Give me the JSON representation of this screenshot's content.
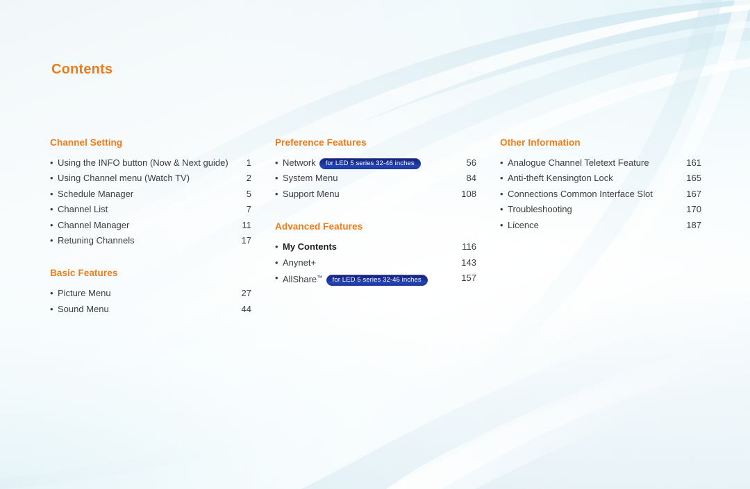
{
  "page": {
    "title": "Contents",
    "accent_orange": "#ef7b18",
    "badge_blue": "#1b3496",
    "text_color": "#3c3c3c",
    "background": "#ffffff"
  },
  "badge_text": "for LED 5 series 32-46 inches",
  "bullet_glyph": "•",
  "columns": [
    {
      "id": "column-1",
      "sections": [
        {
          "title": "Channel Setting",
          "items": [
            {
              "label": "Using the INFO button (Now & Next guide)",
              "page": "1",
              "bold": false,
              "badge": false
            },
            {
              "label": "Using Channel menu (Watch TV)",
              "page": "2",
              "bold": false,
              "badge": false
            },
            {
              "label": "Schedule Manager",
              "page": "5",
              "bold": false,
              "badge": false
            },
            {
              "label": "Channel List",
              "page": "7",
              "bold": false,
              "badge": false
            },
            {
              "label": "Channel Manager",
              "page": "11",
              "bold": false,
              "badge": false
            },
            {
              "label": "Retuning Channels",
              "page": "17",
              "bold": false,
              "badge": false
            }
          ]
        },
        {
          "title": "Basic Features",
          "items": [
            {
              "label": "Picture Menu",
              "page": "27",
              "bold": false,
              "badge": false
            },
            {
              "label": "Sound Menu",
              "page": "44",
              "bold": false,
              "badge": false
            }
          ]
        }
      ]
    },
    {
      "id": "column-2",
      "sections": [
        {
          "title": "Preference Features",
          "items": [
            {
              "label": "Network",
              "page": "56",
              "bold": true,
              "badge": true
            },
            {
              "label": "System Menu",
              "page": "84",
              "bold": false,
              "badge": false
            },
            {
              "label": "Support Menu",
              "page": "108",
              "bold": false,
              "badge": false
            }
          ]
        },
        {
          "title": "Advanced Features",
          "items": [
            {
              "label": "My Contents",
              "page": "116",
              "bold": true,
              "badge": false
            },
            {
              "label": "Anynet+",
              "page": "143",
              "bold": false,
              "badge": false
            },
            {
              "label": "AllShare",
              "trademark": true,
              "page": "157",
              "bold": true,
              "badge": true
            }
          ]
        }
      ]
    },
    {
      "id": "column-3",
      "sections": [
        {
          "title": "Other Information",
          "items": [
            {
              "label": "Analogue Channel Teletext Feature",
              "page": "161",
              "bold": false,
              "badge": false
            },
            {
              "label": "Anti-theft Kensington Lock",
              "page": "165",
              "bold": false,
              "badge": false
            },
            {
              "label": "Connections Common Interface Slot",
              "page": "167",
              "bold": false,
              "badge": false
            },
            {
              "label": "Troubleshooting",
              "page": "170",
              "bold": false,
              "badge": false
            },
            {
              "label": "Licence",
              "page": "187",
              "bold": false,
              "badge": false
            }
          ]
        }
      ]
    }
  ]
}
